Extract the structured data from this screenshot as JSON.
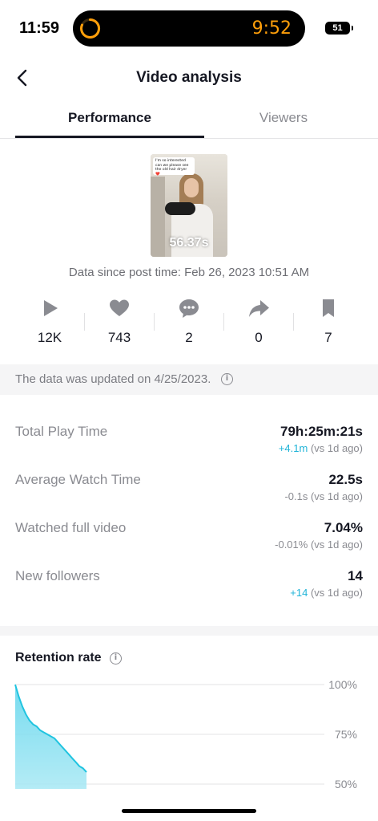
{
  "status_bar": {
    "time": "11:59",
    "timer": "9:52",
    "battery": "51"
  },
  "header": {
    "title": "Video analysis"
  },
  "tabs": [
    {
      "label": "Performance"
    },
    {
      "label": "Viewers"
    }
  ],
  "video": {
    "duration": "56.37s",
    "caption": "I'm so interested can we please see the old hair dryer ❤️",
    "posted": "Data since post time: Feb 26, 2023 10:51 AM"
  },
  "metrics": [
    {
      "icon": "play-icon",
      "value": "12K"
    },
    {
      "icon": "heart-icon",
      "value": "743"
    },
    {
      "icon": "comment-icon",
      "value": "2"
    },
    {
      "icon": "share-icon",
      "value": "0"
    },
    {
      "icon": "bookmark-icon",
      "value": "7"
    }
  ],
  "update_notice": "The data was updated on 4/25/2023.",
  "stats": [
    {
      "label": "Total Play Time",
      "value": "79h:25m:21s",
      "delta": "+4.1m",
      "delta_suffix": " (vs 1d ago)",
      "positive": true
    },
    {
      "label": "Average Watch Time",
      "value": "22.5s",
      "delta": "-0.1s",
      "delta_suffix": " (vs 1d ago)",
      "positive": false
    },
    {
      "label": "Watched full video",
      "value": "7.04%",
      "delta": "-0.01%",
      "delta_suffix": " (vs 1d ago)",
      "positive": false
    },
    {
      "label": "New followers",
      "value": "14",
      "delta": "+14",
      "delta_suffix": " (vs 1d ago)",
      "positive": true
    }
  ],
  "retention": {
    "title": "Retention rate"
  },
  "colors": {
    "accent": "#20b4d8",
    "timer": "#ff9f0a",
    "text": "#161823",
    "muted": "#8a8b91"
  },
  "chart_data": {
    "type": "area",
    "title": "Retention rate",
    "y_tick_labels": [
      "100%",
      "75%",
      "50%"
    ],
    "ylim": [
      50,
      100
    ],
    "x": [
      0,
      1,
      2,
      3,
      4,
      5,
      6,
      7,
      8,
      9,
      10,
      11,
      12,
      13,
      14,
      15,
      16,
      17,
      18,
      19,
      20
    ],
    "series": [
      {
        "values": [
          100,
          94,
          89,
          85,
          82,
          80,
          79,
          77,
          76,
          75,
          74,
          73,
          71,
          69,
          67,
          65,
          63,
          61,
          59,
          58,
          56
        ]
      }
    ],
    "grid": true
  }
}
